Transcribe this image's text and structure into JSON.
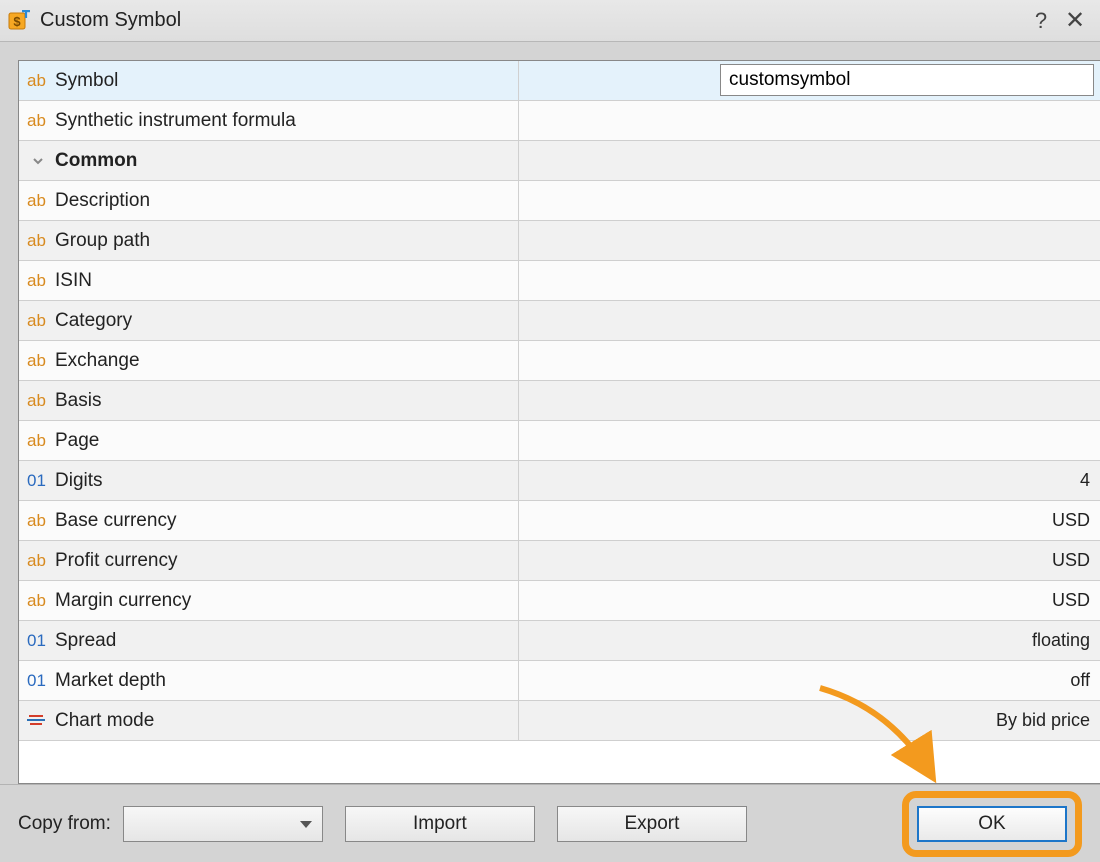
{
  "window": {
    "title": "Custom Symbol"
  },
  "symbol_input": "customsymbol",
  "rows": [
    {
      "icon": "ab",
      "label": "Symbol",
      "value": "",
      "sel": true,
      "input": true
    },
    {
      "icon": "ab",
      "label": "Synthetic instrument formula",
      "value": ""
    },
    {
      "icon": "chev",
      "label": "Common",
      "value": "",
      "bold": true
    },
    {
      "icon": "ab",
      "label": "Description",
      "value": ""
    },
    {
      "icon": "ab",
      "label": "Group path",
      "value": ""
    },
    {
      "icon": "ab",
      "label": "ISIN",
      "value": ""
    },
    {
      "icon": "ab",
      "label": "Category",
      "value": ""
    },
    {
      "icon": "ab",
      "label": "Exchange",
      "value": ""
    },
    {
      "icon": "ab",
      "label": "Basis",
      "value": ""
    },
    {
      "icon": "ab",
      "label": "Page",
      "value": ""
    },
    {
      "icon": "01",
      "label": "Digits",
      "value": "4"
    },
    {
      "icon": "ab",
      "label": "Base currency",
      "value": "USD"
    },
    {
      "icon": "ab",
      "label": "Profit currency",
      "value": "USD"
    },
    {
      "icon": "ab",
      "label": "Margin currency",
      "value": "USD"
    },
    {
      "icon": "01",
      "label": "Spread",
      "value": "floating"
    },
    {
      "icon": "01",
      "label": "Market depth",
      "value": "off"
    },
    {
      "icon": "chart",
      "label": "Chart mode",
      "value": "By bid price"
    }
  ],
  "buttons": {
    "copy_from": "Copy from:",
    "import": "Import",
    "export": "Export",
    "ok": "OK"
  }
}
